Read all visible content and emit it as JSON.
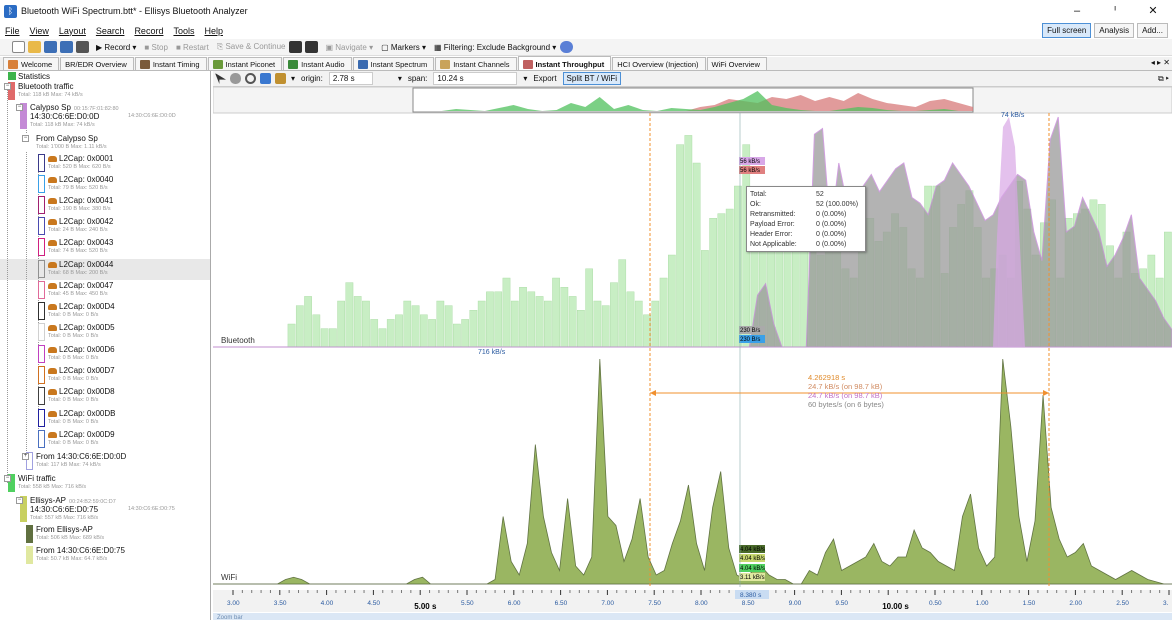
{
  "window": {
    "title": "Bluetooth WiFi Spectrum.btt* - Ellisys Bluetooth Analyzer",
    "controls": [
      "–",
      "ᑊ",
      "✕"
    ]
  },
  "menu": [
    "File",
    "View",
    "Layout",
    "Search",
    "Record",
    "Tools",
    "Help"
  ],
  "view_buttons": [
    "Full screen",
    "Analysis",
    "Add..."
  ],
  "toolbar": {
    "record": "Record",
    "stop": "Stop",
    "restart": "Restart",
    "save_continue": "Save & Continue",
    "navigate": "Navigate",
    "markers": "Markers",
    "filtering": "Filtering: Exclude Background"
  },
  "tabs": [
    "Welcome",
    "BR/EDR Overview",
    "Instant Timing",
    "Instant Piconet",
    "Instant Audio",
    "Instant Spectrum",
    "Instant Channels",
    "Instant Throughput",
    "HCI Overview (Injection)",
    "WiFi Overview"
  ],
  "active_tab": "Instant Throughput",
  "tree": [
    {
      "label": "Statistics",
      "sub": "",
      "color": "#3cb44b"
    },
    {
      "label": "Bluetooth traffic",
      "sub": "Total: 118 kB Max: 74 kB/s",
      "color": "#e06a6a"
    },
    {
      "label": "Calypso Sp",
      "sub2": "00:15:7F:01:82:80",
      "label2": "14:30:C6:6E:D0:0D",
      "sub3": "14:30:C6:6E:D0:0D",
      "sub": "Total: 118 kB Max: 74 kB/s",
      "color": "#c48ad6"
    },
    {
      "label": "From Calypso Sp",
      "sub": "Total: 1'000 B Max: 1.11 kB/s",
      "color": "#ffffff"
    },
    {
      "label": "L2Cap: 0x0001",
      "sub": "Total: 520 B Max: 620 B/s",
      "color": "#3a3a8a"
    },
    {
      "label": "L2Cap: 0x0040",
      "sub": "Total: 79 B Max: 520 B/s",
      "color": "#3aa0e8"
    },
    {
      "label": "L2Cap: 0x0041",
      "sub": "Total: 190 B Max: 380 B/s",
      "color": "#a02070"
    },
    {
      "label": "L2Cap: 0x0042",
      "sub": "Total: 24 B Max: 240 B/s",
      "color": "#4a4ab0"
    },
    {
      "label": "L2Cap: 0x0043",
      "sub": "Total: 74 B Max: 520 B/s",
      "color": "#d02080"
    },
    {
      "label": "L2Cap: 0x0044",
      "sub": "Total: 68 B Max: 200 B/s",
      "color": "#909090"
    },
    {
      "label": "L2Cap: 0x0047",
      "sub": "Total: 45 B Max: 450 B/s",
      "color": "#e06a9a"
    },
    {
      "label": "L2Cap: 0x00D4",
      "sub": "Total: 0 B Max: 0 B/s",
      "color": "#303030"
    },
    {
      "label": "L2Cap: 0x00D5",
      "sub": "Total: 0 B Max: 0 B/s",
      "color": "#d0d0d0"
    },
    {
      "label": "L2Cap: 0x00D6",
      "sub": "Total: 0 B Max: 0 B/s",
      "color": "#c040c0"
    },
    {
      "label": "L2Cap: 0x00D7",
      "sub": "Total: 0 B Max: 0 B/s",
      "color": "#d07020"
    },
    {
      "label": "L2Cap: 0x00D8",
      "sub": "Total: 0 B Max: 0 B/s",
      "color": "#404040"
    },
    {
      "label": "L2Cap: 0x00DB",
      "sub": "Total: 0 B Max: 0 B/s",
      "color": "#2020a0"
    },
    {
      "label": "L2Cap: 0x00D9",
      "sub": "Total: 0 B Max: 0 B/s",
      "color": "#4a70c0"
    },
    {
      "label": "From 14:30:C6:6E:D0:0D",
      "sub": "Total: 117 kB Max: 74 kB/s",
      "color": "#a0a0e0"
    },
    {
      "label": "WiFi traffic",
      "sub": "Total: 558 kB Max: 716 kB/s",
      "color": "#50d060"
    },
    {
      "label": "Ellisys-AP",
      "sub2": "00:24:B2:59:0C:D7",
      "label2": "14:30:C6:6E:D0:75",
      "sub3": "14:30:C6:6E:D0:75",
      "sub": "Total: 557 kB Max: 716 kB/s",
      "color": "#c8d060"
    },
    {
      "label": "From Ellisys-AP",
      "sub": "Total: 506 kB Max: 689 kB/s",
      "color": "#607040"
    },
    {
      "label": "From 14:30:C6:6E:D0:75",
      "sub": "Total: 50.7 kB Max: 64.7 kB/s",
      "color": "#e0e8a0"
    }
  ],
  "chart_toolbar": {
    "origin_label": "origin:",
    "origin_value": "2.78 s",
    "span_label": "span:",
    "span_value": "10.24 s",
    "export": "Export",
    "split": "Split BT / WiFi"
  },
  "chart_data": {
    "type": "area",
    "x_axis": {
      "ticks": [
        "3.00",
        "3.50",
        "4.00",
        "4.50",
        "5.00 s",
        "5.50",
        "6.00",
        "6.50",
        "7.00",
        "7.50",
        "8.00",
        "8.50",
        "9.00",
        "9.50",
        "10.00 s",
        "0.50",
        "1.00",
        "1.50",
        "2.00",
        "2.50",
        "3."
      ],
      "range": [
        2.78,
        13.02
      ],
      "cursor": "8.380 s",
      "bottom_label": "Zoom bar"
    },
    "panes": [
      {
        "name": "Bluetooth",
        "peak_label": "74 kB/s",
        "labels": [
          "56 kB/s",
          "56 kB/s",
          "230 B/s",
          "230 B/s"
        ],
        "bars_green": [
          0,
          0,
          0,
          0,
          0,
          0,
          0,
          0,
          0,
          10,
          18,
          22,
          14,
          8,
          8,
          20,
          28,
          22,
          20,
          12,
          8,
          12,
          14,
          20,
          18,
          14,
          12,
          20,
          18,
          10,
          12,
          16,
          20,
          24,
          24,
          30,
          20,
          26,
          24,
          22,
          20,
          30,
          26,
          22,
          16,
          34,
          20,
          18,
          28,
          38,
          24,
          20,
          14,
          20,
          30,
          40,
          88,
          92,
          80,
          42,
          56,
          58,
          60,
          70,
          88,
          66,
          62,
          52,
          58,
          52,
          46,
          48,
          50,
          40,
          52,
          54,
          34,
          30,
          48,
          56,
          46,
          50,
          58,
          52,
          34,
          30,
          70,
          70,
          32,
          52,
          62,
          68,
          52,
          30,
          34,
          40,
          30,
          72,
          60,
          40,
          54,
          64,
          30,
          56,
          58,
          60,
          64,
          62,
          44,
          30,
          50,
          32,
          34,
          40,
          30,
          50
        ],
        "bt_area": [
          0,
          0,
          0,
          0,
          0,
          0,
          0,
          0,
          0,
          0,
          0,
          0,
          0,
          0,
          0,
          0,
          0,
          0,
          0,
          0,
          0,
          0,
          0,
          0,
          0,
          0,
          0,
          0,
          0,
          0,
          0,
          0,
          0,
          0,
          0,
          0,
          0,
          0,
          0,
          0,
          0,
          0,
          0,
          0,
          0,
          0,
          0,
          0,
          0,
          0,
          0,
          0,
          0,
          0,
          0,
          0,
          0,
          0,
          0,
          0,
          0,
          0,
          0,
          0,
          0,
          0,
          0,
          18,
          22,
          8,
          0,
          0,
          0,
          0,
          74,
          76,
          40,
          64,
          50,
          52,
          56,
          60,
          54,
          58,
          62,
          64,
          52,
          50,
          46,
          56,
          58,
          64,
          60,
          56,
          50,
          44,
          46,
          52,
          56,
          60,
          58,
          40,
          30,
          72,
          80,
          40,
          42,
          52,
          46,
          40,
          28,
          32,
          38,
          46,
          24,
          20,
          16,
          10,
          6
        ]
      },
      {
        "name": "WiFi",
        "peak_label": "716 kB/s",
        "labels": [
          "4.04 kB/s",
          "4.04 kB/s",
          "4.04 kB/s",
          "3.11 kB/s"
        ],
        "wifi_area": [
          0,
          0,
          0,
          0,
          0,
          0,
          0,
          0,
          0,
          2,
          3,
          2,
          0,
          0,
          0,
          0,
          0,
          0,
          0,
          0,
          0,
          0,
          0,
          0,
          0,
          2,
          3,
          0,
          0,
          0,
          0,
          0,
          0,
          0,
          0,
          2,
          30,
          10,
          4,
          18,
          62,
          30,
          14,
          6,
          38,
          8,
          4,
          12,
          100,
          30,
          26,
          10,
          20,
          38,
          12,
          4,
          6,
          18,
          28,
          44,
          18,
          6,
          34,
          50,
          16,
          4,
          2,
          6,
          8,
          4,
          2,
          2,
          0,
          0,
          6,
          4,
          14,
          20,
          6,
          8,
          10,
          12,
          18,
          10,
          8,
          12,
          12,
          24,
          16,
          14,
          10,
          8,
          6,
          30,
          40,
          16,
          8,
          12,
          100,
          70,
          30,
          10,
          28,
          84,
          34,
          20,
          12,
          14,
          18,
          8,
          6,
          4,
          2,
          4,
          6,
          4,
          2,
          1,
          0,
          0
        ]
      }
    ],
    "overview": {
      "wifi_color": "#4fc05c",
      "bt_color": "#d77a7a"
    }
  },
  "tooltip": {
    "rows": [
      [
        "Total:",
        "52"
      ],
      [
        "Ok:",
        "52 (100.00%)"
      ],
      [
        "Retransmitted:",
        "0 (0.00%)"
      ],
      [
        "Payload Error:",
        "0 (0.00%)"
      ],
      [
        "Header Error:",
        "0 (0.00%)"
      ],
      [
        "Not Applicable:",
        "0 (0.00%)"
      ]
    ]
  },
  "measure": {
    "time": "4.262918 s",
    "rate1": "24.7 kB/s (on 98.7 kB)",
    "rate2": "24.7 kB/s (on 98.7 kB)",
    "rate3": "60 bytes/s (on 6 bytes)"
  },
  "colors": {
    "bt_fill": "#9a9a9a",
    "bt_line": "#c27fd6",
    "green_bar": "#c8eec4",
    "wifi_fill": "#8fae55",
    "wifi_line": "#4a5e2a",
    "marker": "#f0902e"
  }
}
